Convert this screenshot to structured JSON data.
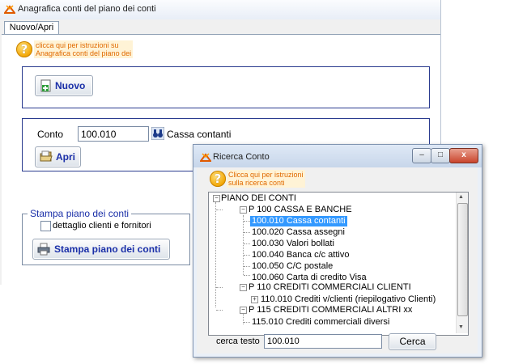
{
  "main_window": {
    "title": "Anagrafica conti del piano dei conti",
    "tab_label": "Nuovo/Apri",
    "help_text_line1": "clicca qui per istruzioni su",
    "help_text_line2": "Anagrafica conti del piano dei",
    "new_button_label": "Nuovo",
    "conto_label": "Conto",
    "conto_value": "100.010",
    "conto_description": "Cassa contanti",
    "open_button_label": "Apri",
    "print_group_title": "Stampa piano dei conti",
    "detail_checkbox_label": "dettaglio clienti e fornitori",
    "print_button_label": "Stampa piano dei conti"
  },
  "search_window": {
    "title": "Ricerca Conto",
    "help_text_line1": "Clicca qui per istruzioni",
    "help_text_line2": "sulla ricerca conti",
    "tree": {
      "root": "PIANO DEI CONTI",
      "groups": [
        {
          "label": "P 100 CASSA E BANCHE",
          "items": [
            "100.010 Cassa contanti",
            "100.020 Cassa assegni",
            "100.030 Valori bollati",
            "100.040 Banca c/c attivo",
            "100.050 C/C postale",
            "100.060 Carta di credito Visa"
          ]
        },
        {
          "label": "P 110 CREDITI COMMERCIALI CLIENTI",
          "items": [
            "110.010 Crediti v/clienti (riepilogativo Clienti)"
          ]
        },
        {
          "label": "P 115 CREDITI COMMERCIALI ALTRI xx",
          "items": [
            "115.010 Crediti commerciali diversi"
          ]
        }
      ]
    },
    "search_label": "cerca testo",
    "search_value": "100.010",
    "search_button_label": "Cerca",
    "close_glyph": "x",
    "minimize_glyph": "–",
    "maximize_glyph": "□"
  },
  "colors": {
    "selection": "#3399ff",
    "button_text": "#1a2fa8",
    "help_text": "#e06a00",
    "group_border": "#2a3b8f"
  }
}
